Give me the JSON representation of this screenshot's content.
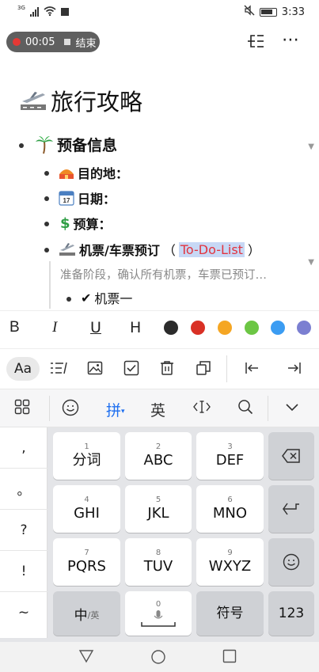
{
  "status": {
    "network": "3G",
    "time": "3:33"
  },
  "recording": {
    "elapsed": "00:05",
    "stop_label": "结束"
  },
  "toolbar": {
    "outline_icon": "outline-icon",
    "more_icon": "more-icon",
    "more_label": "⋯"
  },
  "document": {
    "title": "旅行攻略",
    "sections": [
      {
        "label": "预备信息"
      },
      {
        "label": "目的地："
      },
      {
        "label": "日期："
      },
      {
        "label": "预算："
      },
      {
        "label": "机票/车票预订",
        "paren_open": "（",
        "highlight": "To-Do-List",
        "paren_close": "）"
      }
    ],
    "note": "准备阶段，确认所有机票，车票已预订…",
    "check_item": "机票一"
  },
  "format_bar": {
    "bold": "B",
    "italic": "I",
    "underline": "U",
    "heading": "H",
    "colors": [
      "#2b2b2b",
      "#d93025",
      "#f5a623",
      "#6cc644",
      "#3b9cf2",
      "#7b7fd1"
    ]
  },
  "format_bar2": {
    "font": "Aa"
  },
  "ime": {
    "pinyin": "拼",
    "english": "英"
  },
  "keyboard": {
    "side": [
      ",",
      "。",
      "?",
      "!",
      "~"
    ],
    "keys": [
      {
        "num": "1",
        "label": "分词"
      },
      {
        "num": "2",
        "label": "ABC"
      },
      {
        "num": "3",
        "label": "DEF"
      },
      {
        "num": "4",
        "label": "GHI"
      },
      {
        "num": "5",
        "label": "JKL"
      },
      {
        "num": "6",
        "label": "MNO"
      },
      {
        "num": "7",
        "label": "PQRS"
      },
      {
        "num": "8",
        "label": "TUV"
      },
      {
        "num": "9",
        "label": "WXYZ"
      }
    ],
    "switch_main": "中",
    "switch_sub": "/英",
    "space_num": "0",
    "symbols": "符号",
    "numbers": "123"
  }
}
